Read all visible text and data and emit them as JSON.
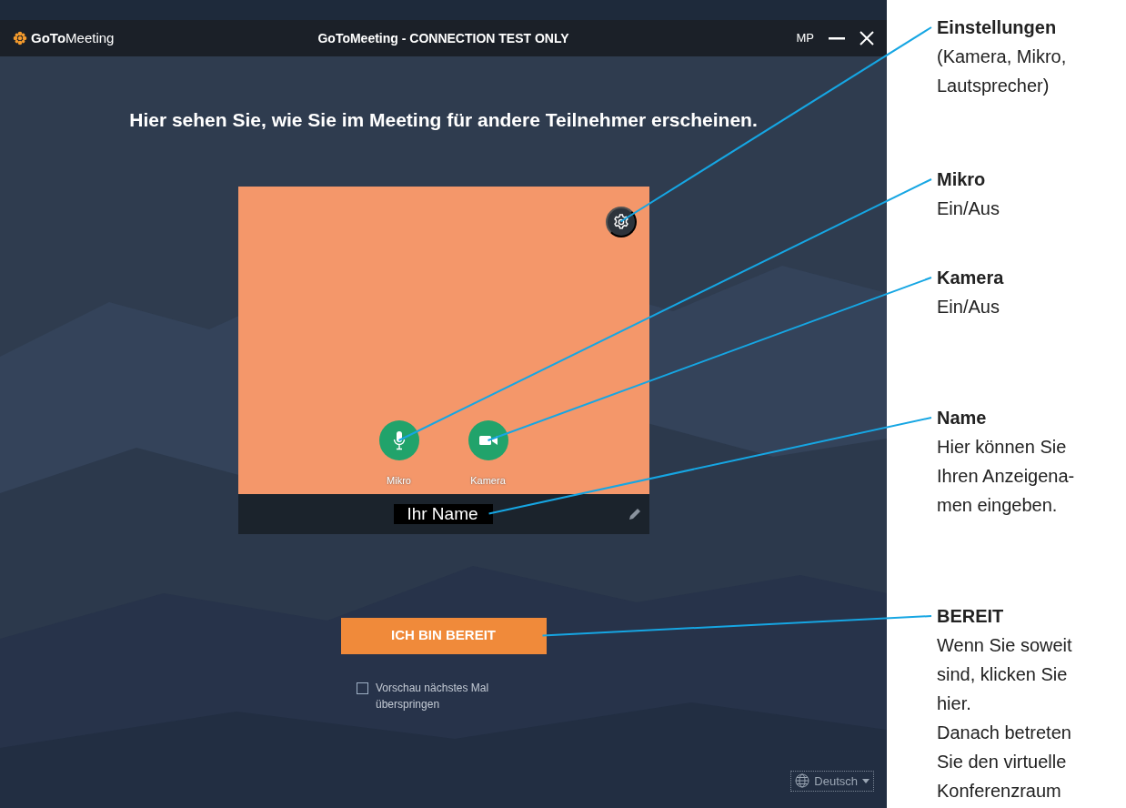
{
  "window": {
    "logo_bold": "GoTo",
    "logo_light": "Meeting",
    "title": "GoToMeeting - CONNECTION TEST ONLY",
    "user_initials": "MP"
  },
  "heading": "Hier sehen Sie, wie Sie im Meeting für andere Teilnehmer erscheinen.",
  "preview": {
    "controls": [
      {
        "kind": "mic",
        "label": "Mikro",
        "on": true
      },
      {
        "kind": "camera",
        "label": "Kamera",
        "on": true
      }
    ],
    "name": "Ihr Name"
  },
  "ready_button": "ICH BIN BEREIT",
  "skip_checkbox": {
    "label": "Vorschau nächstes Mal überspringen",
    "checked": false
  },
  "language": "Deutsch",
  "callouts": [
    {
      "title": "Einstellungen",
      "lines": [
        "(Kamera, Mikro,",
        "Lautsprecher)"
      ]
    },
    {
      "title": "Mikro",
      "lines": [
        "Ein/Aus"
      ]
    },
    {
      "title": "Kamera",
      "lines": [
        "Ein/Aus"
      ]
    },
    {
      "title": "Name",
      "lines": [
        "Hier können Sie",
        "Ihren Anzeigena-",
        "men eingeben."
      ]
    },
    {
      "title": "BEREIT",
      "lines": [
        "Wenn Sie soweit",
        "sind, klicken Sie",
        "hier.",
        "Danach betreten",
        "Sie den virtuelle",
        "Konferenzraum"
      ]
    }
  ]
}
